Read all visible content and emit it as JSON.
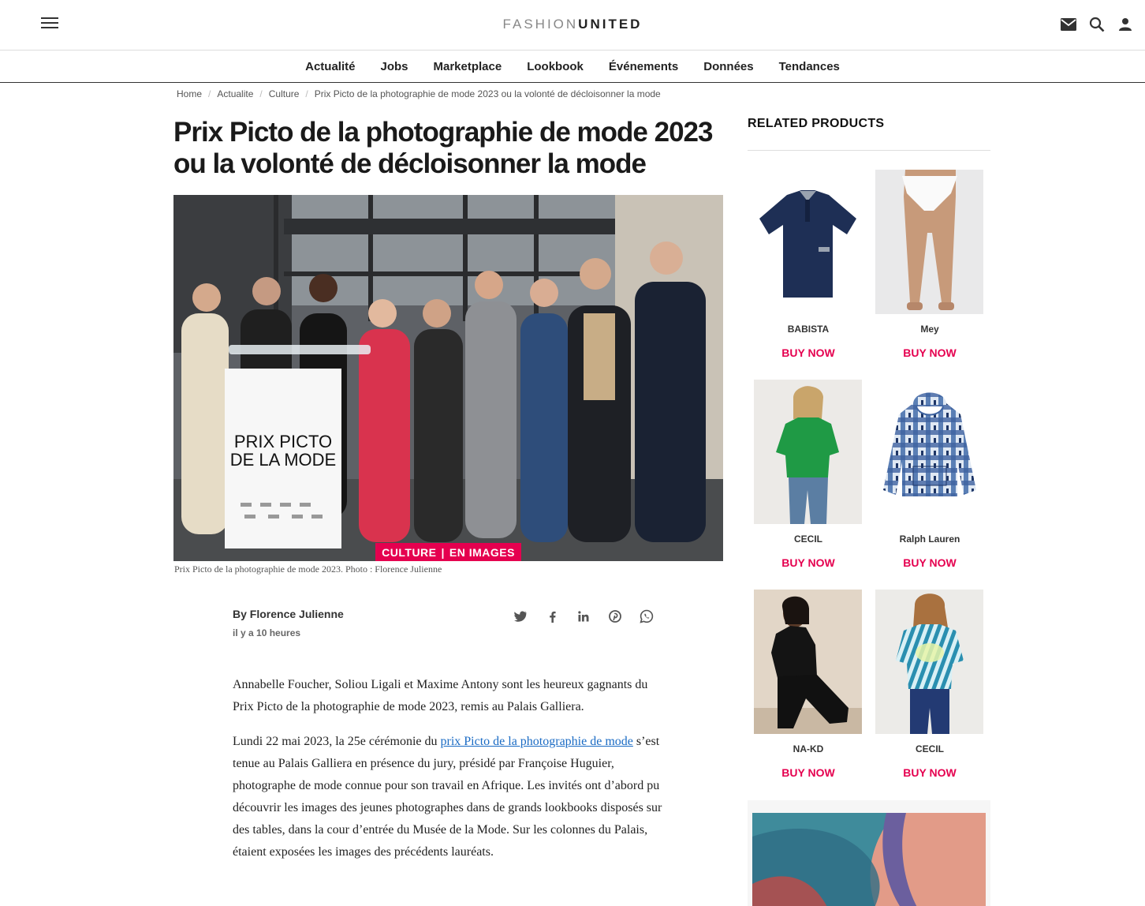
{
  "header": {
    "logo_light": "FASHION",
    "logo_bold": "UNITED",
    "icons": [
      "menu-icon",
      "mail-icon",
      "search-icon",
      "account-icon"
    ]
  },
  "nav": {
    "items": [
      "Actualité",
      "Jobs",
      "Marketplace",
      "Lookbook",
      "Événements",
      "Données",
      "Tendances"
    ]
  },
  "breadcrumb": {
    "items": [
      "Home",
      "Actualite",
      "Culture",
      "Prix Picto de la photographie de mode 2023 ou la volonté de décloisonner la mode"
    ]
  },
  "article": {
    "title": "Prix Picto de la photographie de mode 2023 ou la volonté de décloisonner la mode",
    "hero_tag_left": "CULTURE",
    "hero_tag_right": "EN IMAGES",
    "podium_sign_line1": "PRIX PICTO",
    "podium_sign_line2": "DE LA MODE",
    "caption": "Prix Picto de la photographie de mode 2023. Photo : Florence Julienne",
    "author": "By Florence Julienne",
    "time": "il y a 10 heures",
    "share_icons": [
      "twitter-icon",
      "facebook-icon",
      "linkedin-icon",
      "pinterest-icon",
      "whatsapp-icon"
    ],
    "p1": "Annabelle Foucher, Soliou Ligali et Maxime Antony sont les heureux gagnants du Prix Picto de la photographie de mode 2023, remis au Palais Galliera.",
    "p2_before": "Lundi 22 mai 2023, la 25e cérémonie du ",
    "p2_link": "prix Picto de la photographie de mode",
    "p2_after": " s’est tenue au Palais Galliera en présence du jury, présidé par Françoise Huguier, photographe de mode connue pour son travail en Afrique. Les invités ont d’abord pu découvrir les images des jeunes photographes dans de grands lookbooks disposés sur des tables, dans la cour d’entrée du Musée de la Mode. Sur les colonnes du Palais, étaient exposées les images des précédents lauréats."
  },
  "sidebar": {
    "title": "RELATED PRODUCTS",
    "buy_label": "BUY NOW",
    "products": [
      {
        "brand": "BABISTA"
      },
      {
        "brand": "Mey"
      },
      {
        "brand": "CECIL"
      },
      {
        "brand": "Ralph Lauren"
      },
      {
        "brand": "NA-KD"
      },
      {
        "brand": "CECIL"
      }
    ]
  },
  "colors": {
    "accent": "#e5004f",
    "link": "#1a6bc4"
  }
}
